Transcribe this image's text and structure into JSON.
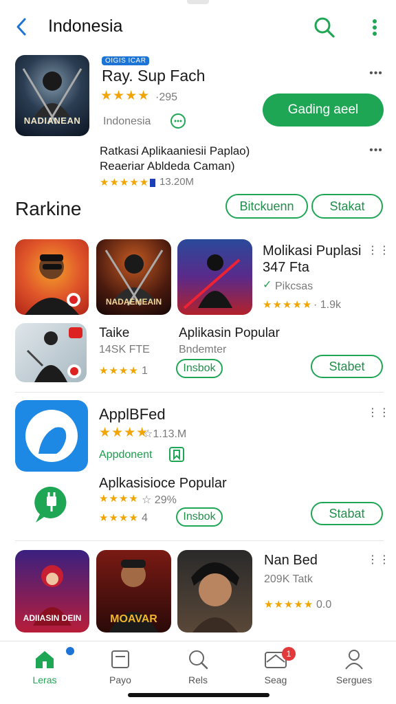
{
  "header": {
    "title": "Indonesia"
  },
  "featured": {
    "chip": "OIGIS ICAR",
    "title": "Ray. Sup Fach",
    "stars": "★★★★",
    "rating_text": "·295",
    "country": "Indonesia",
    "install_label": "Gading aeel",
    "poster_text": "NADIANEAN",
    "sub_title_1": "Ratkasi Aplikaaniesii Paplao)",
    "sub_title_2": "Reaeriar Abldeda Caman)",
    "sub_stars": "★★★★★",
    "sub_meta": "13.20M"
  },
  "ranking": {
    "title": "Rarkine",
    "chip1": "Bitckuenn",
    "chip2": "Stakat"
  },
  "row1": {
    "tile2_text": "NADAEMEAIN",
    "side_title": "Molikasi Puplasi",
    "side_sub": "347 Fta",
    "side_cat": "Pikcsas",
    "side_stars": "★★★★★",
    "side_meta": "· 1.9k"
  },
  "row2": {
    "name1": "Taike",
    "meta1": "14SK FTE",
    "stars1": "★★★★",
    "rating1": "1",
    "name2": "Aplikasin Popular",
    "meta2": "Bndemter",
    "install_chip": "Insbok",
    "button": "Stabet"
  },
  "app_block": {
    "title": "ApplBFed",
    "stars": "★★★★",
    "meta": "☆1.13.M",
    "category": "Appdonent",
    "sub_title": "Aplkasisioce Popular",
    "sub_stars": "★★★★",
    "sub_meta": "☆ 29%",
    "small_stars": "★★★★",
    "small_rating": "4",
    "install_chip": "Insbok",
    "button": "Stabat"
  },
  "row3": {
    "tile1_text": "ADIIASIN DEIN",
    "tile2_text": "MOAVAR",
    "side_title": "Nan Bed",
    "side_meta": "209K Tatk",
    "side_stars": "★★★★★",
    "side_rating": "0.0"
  },
  "nav": {
    "items": [
      {
        "label": "Leras",
        "icon": "home-icon"
      },
      {
        "label": "Payo",
        "icon": "square-icon"
      },
      {
        "label": "Rels",
        "icon": "search-icon"
      },
      {
        "label": "Seag",
        "icon": "mail-icon"
      },
      {
        "label": "Sergues",
        "icon": "person-icon"
      }
    ],
    "badge": "1"
  },
  "colors": {
    "accent_green": "#1fa655",
    "accent_blue": "#1b74d6",
    "star": "#f0a500"
  }
}
